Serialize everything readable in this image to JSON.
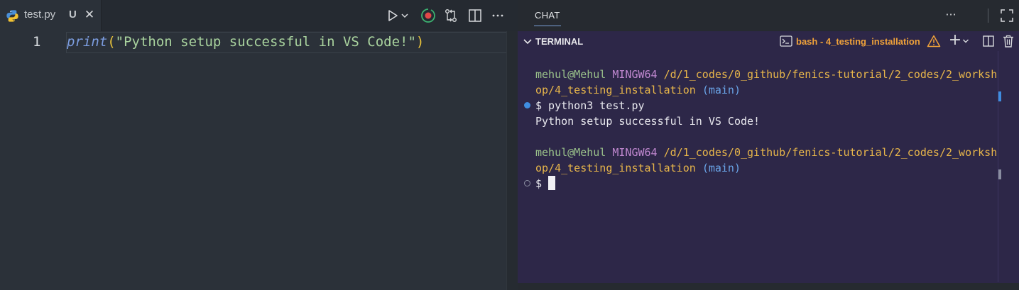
{
  "editor": {
    "tab": {
      "filename": "test.py",
      "badge": "U"
    },
    "line_number": "1",
    "code": {
      "fn": "print",
      "open_paren": "(",
      "string": "\"Python setup successful in VS Code!\"",
      "close_paren": ")"
    },
    "icons": [
      "python-icon",
      "close-icon",
      "run-icon",
      "chevron-down-icon",
      "record-icon",
      "compare-icon",
      "split-editor-icon",
      "more-icon"
    ]
  },
  "chat": {
    "title": "CHAT",
    "more": "···"
  },
  "terminal": {
    "title": "TERMINAL",
    "shell_name": "bash - 4_testing_installation",
    "add": "+",
    "lines": [
      {
        "user": "mehul@Mehul",
        "host": "MINGW64",
        "path1": "/d/1_codes/0_github/fenics-tutorial/2_codes/2_worksh",
        "path2": "op/4_testing_installation",
        "branch": "(main)"
      },
      {
        "command": "$ python3 test.py",
        "output": "Python setup successful in VS Code!"
      },
      {
        "user": "mehul@Mehul",
        "host": "MINGW64",
        "path1": "/d/1_codes/0_github/fenics-tutorial/2_codes/2_worksh",
        "path2": "op/4_testing_installation",
        "branch": "(main)"
      },
      {
        "prompt": "$"
      }
    ]
  },
  "colors": {
    "editor_bg": "#2b3139",
    "terminal_bg": "#2d2748",
    "shell_name": "#f0a23a",
    "accent": "#3f8de0"
  }
}
